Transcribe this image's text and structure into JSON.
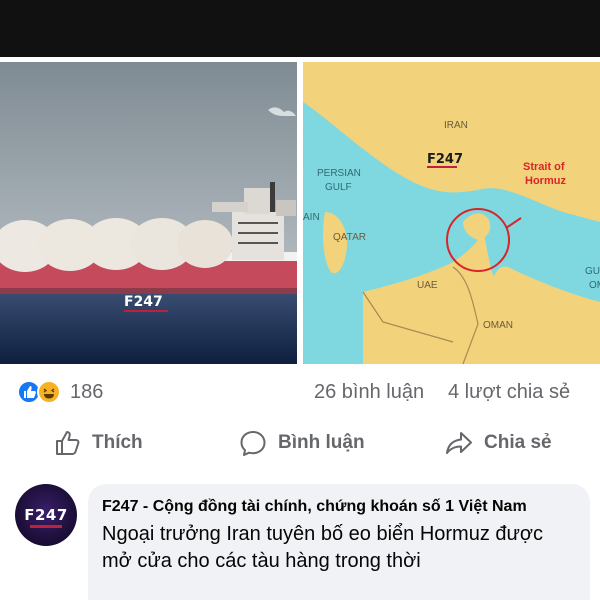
{
  "post": {
    "images": [
      {
        "icon": "lng-tanker-photo",
        "watermark": "F247"
      },
      {
        "icon": "strait-of-hormuz-map",
        "watermark": "F247",
        "labels": {
          "iran": "IRAN",
          "persian_gulf": "PERSIAN\nGULF",
          "strait": "Strait of\nHormuz",
          "bahrain": "AIN",
          "qatar": "QATAR",
          "uae": "UAE",
          "oman": "OMAN",
          "gulf_right": "GUL\nOM"
        }
      }
    ],
    "reactions": {
      "icons": [
        "like-icon",
        "haha-icon"
      ],
      "count": "186",
      "comments": "26 bình luận",
      "shares": "4 lượt chia sẻ"
    },
    "actions": {
      "like_label": "Thích",
      "comment_label": "Bình luận",
      "share_label": "Chia sẻ"
    }
  },
  "comment": {
    "avatar_text": "F247",
    "author": "F247 - Cộng đồng tài chính, chứng khoán số 1 Việt Nam",
    "text": "Ngoại trưởng Iran tuyên bố eo biển Hormuz được mở cửa cho các tàu hàng trong thời"
  },
  "colors": {
    "accent": "#1877f2",
    "map_land": "#f2d27a",
    "map_water": "#7fd8e0",
    "strait_circle": "#d9242a"
  }
}
